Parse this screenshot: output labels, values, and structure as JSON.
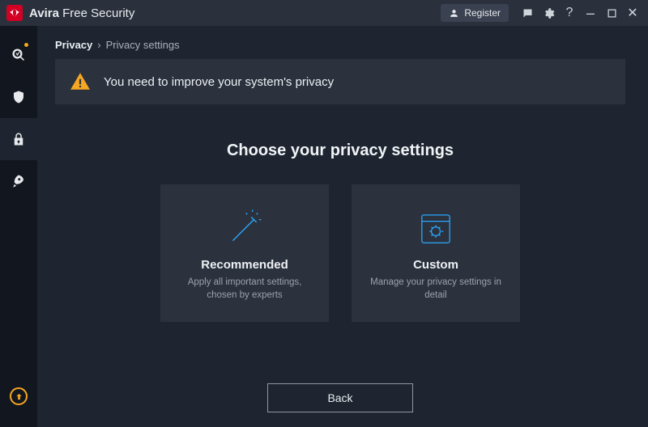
{
  "titlebar": {
    "brand_bold": "Avira",
    "brand_rest": " Free Security",
    "register_label": "Register"
  },
  "breadcrumb": {
    "root": "Privacy",
    "sep": "›",
    "current": "Privacy settings"
  },
  "alert": {
    "text": "You need to improve your system's privacy"
  },
  "heading": "Choose your privacy settings",
  "cards": {
    "recommended": {
      "title": "Recommended",
      "sub": "Apply all important settings, chosen by experts"
    },
    "custom": {
      "title": "Custom",
      "sub": "Manage your privacy settings in detail"
    }
  },
  "footer": {
    "back_label": "Back"
  }
}
